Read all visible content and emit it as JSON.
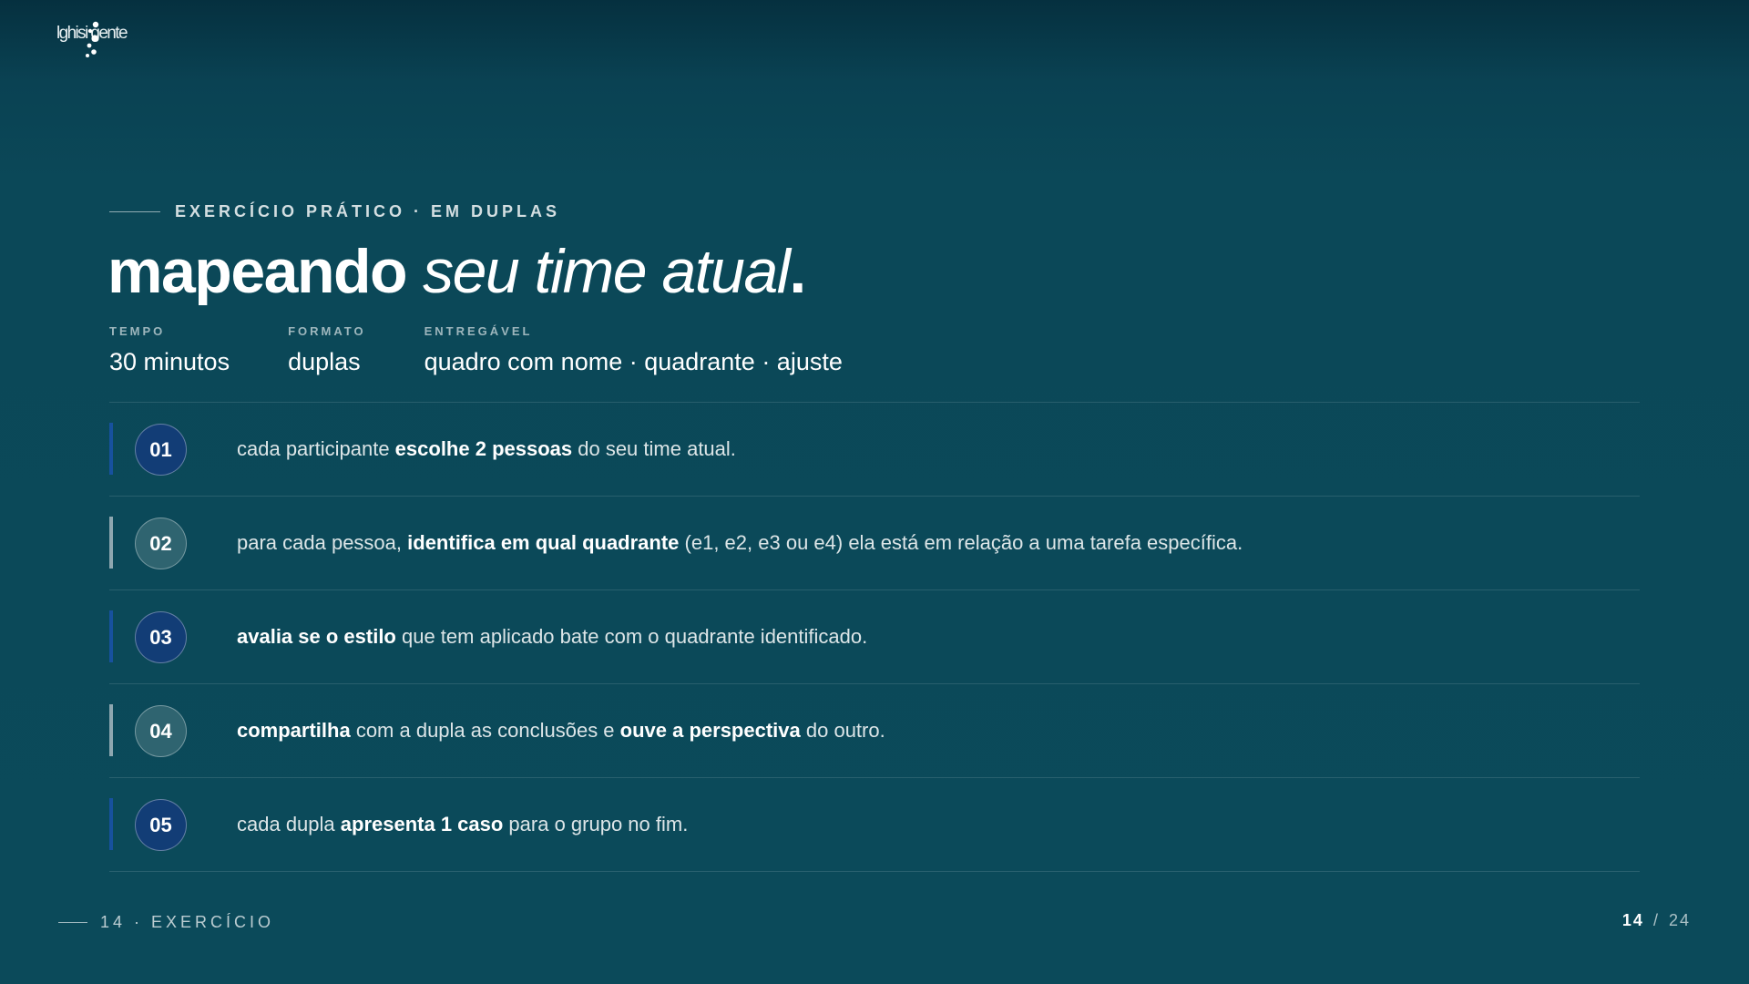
{
  "logo": {
    "text": "lghisi gente"
  },
  "eyebrow": "EXERCÍCIO PRÁTICO · EM DUPLAS",
  "headline": {
    "bold": "mapeando",
    "italic": "seu time atual",
    "dot": "."
  },
  "meta": [
    {
      "label": "TEMPO",
      "value": "30 minutos"
    },
    {
      "label": "FORMATO",
      "value": "duplas"
    },
    {
      "label": "ENTREGÁVEL",
      "value": "quadro com nome · quadrante · ajuste"
    }
  ],
  "steps": [
    {
      "num": "01",
      "pre": "cada participante ",
      "bold1": "escolhe 2 pessoas",
      "mid": " do seu time atual.",
      "bold2": "",
      "post": ""
    },
    {
      "num": "02",
      "pre": "para cada pessoa, ",
      "bold1": "identifica em qual quadrante",
      "mid": " (e1, e2, e3 ou e4) ela está em relação a uma tarefa específica.",
      "bold2": "",
      "post": ""
    },
    {
      "num": "03",
      "pre": "",
      "bold1": "avalia se o estilo",
      "mid": " que tem aplicado bate com o quadrante identificado.",
      "bold2": "",
      "post": ""
    },
    {
      "num": "04",
      "pre": "",
      "bold1": "compartilha",
      "mid": " com a dupla as conclusões e ",
      "bold2": "ouve a perspectiva",
      "post": " do outro."
    },
    {
      "num": "05",
      "pre": "cada dupla ",
      "bold1": "apresenta 1 caso",
      "mid": " para o grupo no fim.",
      "bold2": "",
      "post": ""
    }
  ],
  "footer": {
    "section": "14 · EXERCÍCIO",
    "page_current": "14",
    "page_separator": "/",
    "page_total": "24"
  },
  "colors": {
    "background": "#0b4858",
    "badge_primary": "#123d76",
    "badge_alt": "#2f6470",
    "accent_bar": "#17519e"
  }
}
